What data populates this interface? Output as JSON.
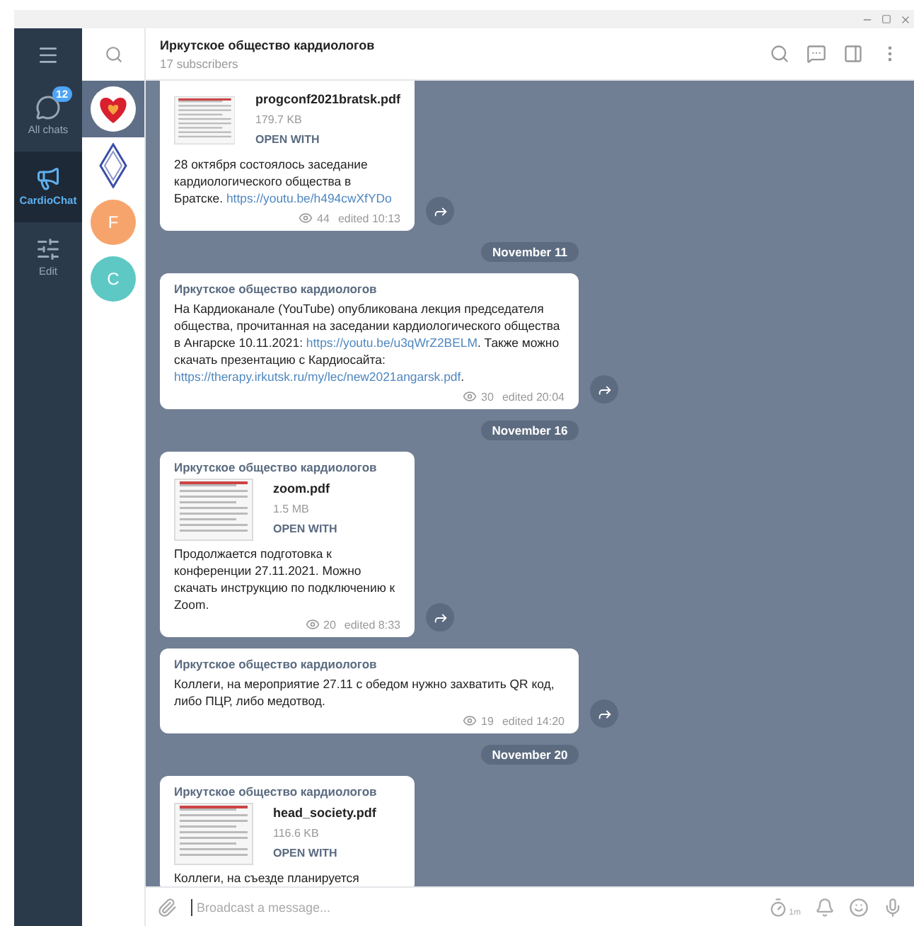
{
  "folders": [
    {
      "kind": "chats",
      "label": "All chats",
      "badge": "12",
      "selected": false
    },
    {
      "kind": "channel",
      "label": "CardioChat",
      "selected": true
    },
    {
      "kind": "edit",
      "label": "Edit",
      "selected": false
    }
  ],
  "chat_list": [
    {
      "kind": "heart",
      "selected": true
    },
    {
      "kind": "logo",
      "selected": false
    },
    {
      "kind": "letter",
      "letter": "F",
      "color": "#f7a46c",
      "selected": false
    },
    {
      "kind": "letter",
      "letter": "C",
      "color": "#5ec8c4",
      "selected": false
    }
  ],
  "header": {
    "title": "Иркутское общество кардиологов",
    "subtitle": "17 subscribers"
  },
  "feed": [
    {
      "kind": "message",
      "file": {
        "name": "progconf2021bratsk.pdf",
        "size": "179.7 KB",
        "action": "OPEN WITH"
      },
      "text": [
        {
          "kind": "plain",
          "text": "28 октября состоялось заседание кардиологического общества в Братске. "
        },
        {
          "kind": "link",
          "text": "https://youtu.be/h494cwXfYDo"
        }
      ],
      "views": "44",
      "time": "edited 10:13"
    },
    {
      "kind": "date",
      "label": "November 11"
    },
    {
      "kind": "message",
      "author": "Иркутское общество кардиологов",
      "text": [
        {
          "kind": "plain",
          "text": "На Кардиоканале (YouTube) опубликована лекция председателя общества, прочитанная на заседании кардиологического общества в Ангарске 10.11.2021: "
        },
        {
          "kind": "link",
          "text": "https://youtu.be/u3qWrZ2BELM"
        },
        {
          "kind": "plain",
          "text": ". Также можно скачать презентацию с Кардиосайта: "
        },
        {
          "kind": "link",
          "text": "https://therapy.irkutsk.ru/my/lec/new2021angarsk.pdf"
        },
        {
          "kind": "plain",
          "text": "."
        }
      ],
      "views": "30",
      "time": "edited 20:04"
    },
    {
      "kind": "date",
      "label": "November 16"
    },
    {
      "kind": "message",
      "author": "Иркутское общество кардиологов",
      "file": {
        "name": "zoom.pdf",
        "size": "1.5 MB",
        "action": "OPEN WITH"
      },
      "text": [
        {
          "kind": "plain",
          "text": "Продолжается подготовка к конференции 27.11.2021. Можно скачать инструкцию по подключению к Zoom."
        }
      ],
      "views": "20",
      "time": "edited 8:33"
    },
    {
      "kind": "message",
      "author": "Иркутское общество кардиологов",
      "text": [
        {
          "kind": "plain",
          "text": "Коллеги, на мероприятие 27.11 с обедом нужно захватить QR код, либо ПЦР, либо медотвод."
        }
      ],
      "views": "19",
      "time": "edited 14:20"
    },
    {
      "kind": "date",
      "label": "November 20"
    },
    {
      "kind": "message",
      "author": "Иркутское общество кардиологов",
      "file": {
        "name": "head_society.pdf",
        "size": "116.6 KB",
        "action": "OPEN WITH"
      },
      "text": [
        {
          "kind": "plain",
          "text": "Коллеги, на съезде планируется"
        }
      ]
    }
  ],
  "composer": {
    "placeholder": "Broadcast a message...",
    "timer": "1m"
  }
}
